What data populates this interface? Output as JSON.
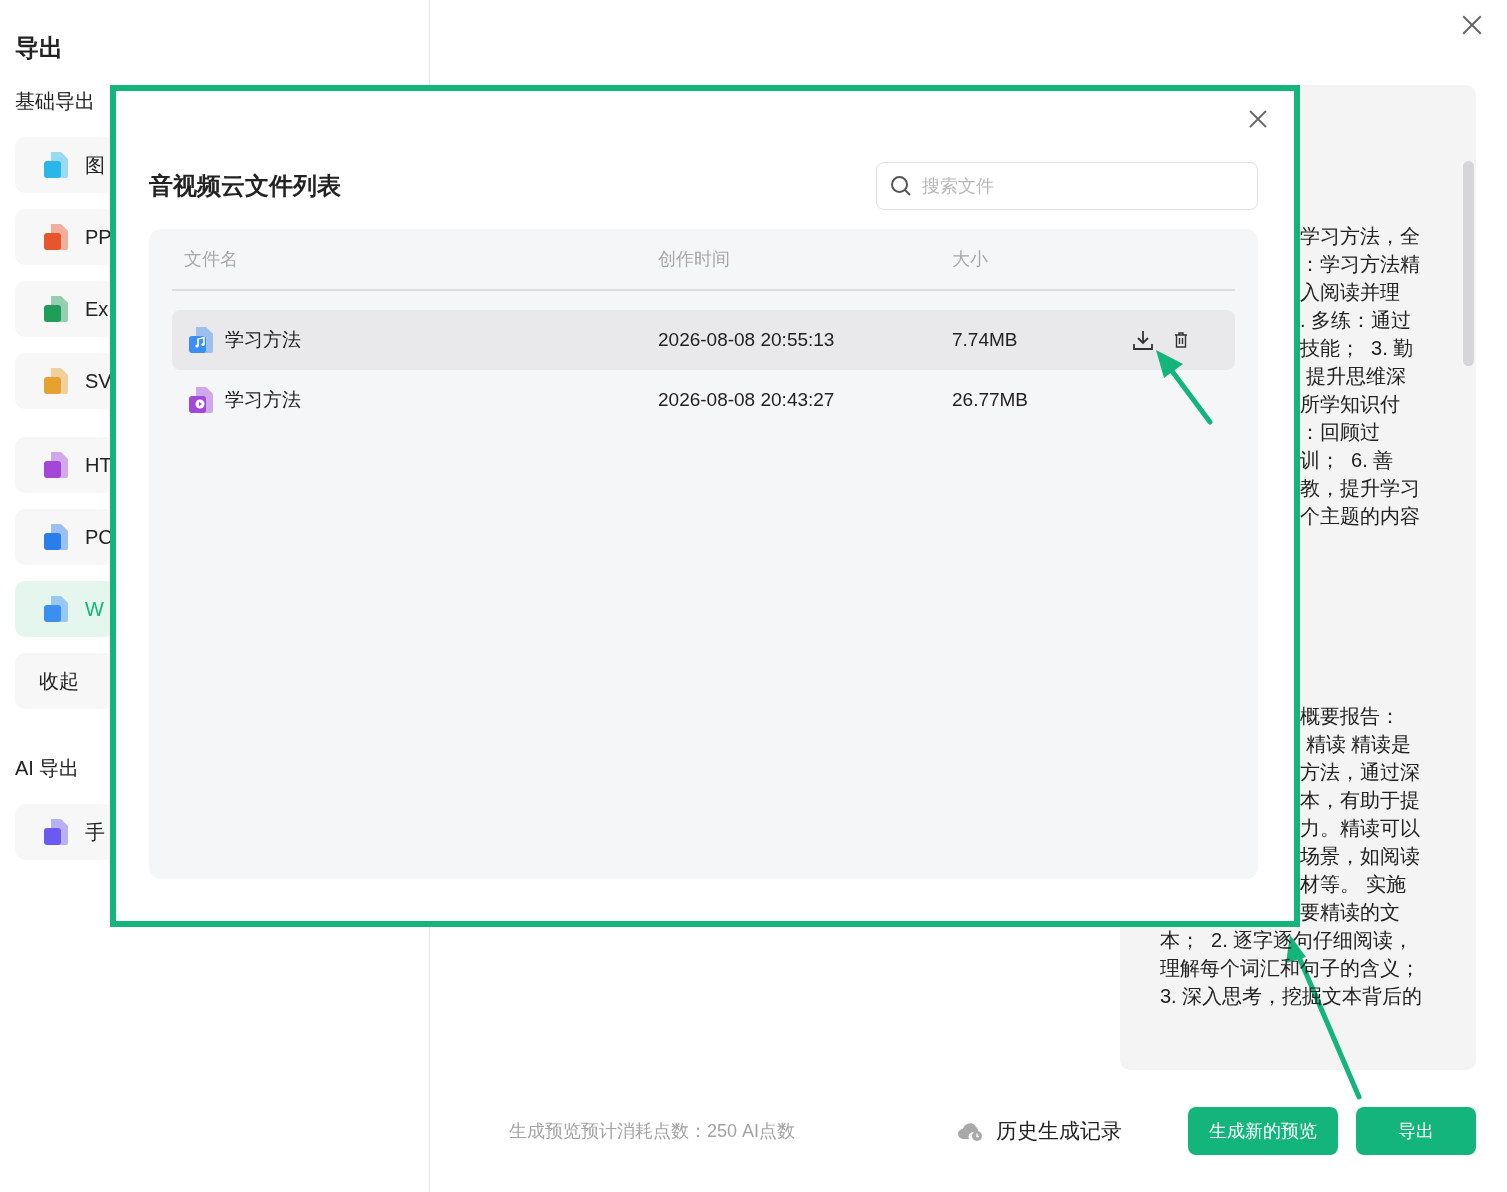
{
  "sidebar": {
    "title": "导出",
    "sections": [
      {
        "heading": "基础导出",
        "items": [
          {
            "kind": "export",
            "label": "图",
            "color": "#29b6e8",
            "selected": false
          },
          {
            "kind": "export",
            "label": "PP",
            "color": "#e8552c",
            "selected": false
          },
          {
            "kind": "export",
            "label": "Ex",
            "color": "#1e9e58",
            "selected": false
          },
          {
            "kind": "export",
            "label": "SV",
            "color": "#e6a12e",
            "selected": false
          },
          {
            "kind": "export",
            "label": "HT",
            "color": "#a347d8",
            "selected": false
          },
          {
            "kind": "export",
            "label": "PC",
            "color": "#2b7de9",
            "selected": false
          },
          {
            "kind": "export",
            "label": "W",
            "color": "#3b8ff0",
            "selected": true
          },
          {
            "kind": "collapse",
            "label": "收起",
            "selected": false
          }
        ]
      },
      {
        "heading": "AI 导出",
        "items": [
          {
            "kind": "export",
            "label": "手",
            "color": "#6a5af0",
            "selected": false
          }
        ]
      }
    ]
  },
  "preview": {
    "paragraphs": [
      {
        "lines": [
          {
            "text": "学习方法，全",
            "clipped": true
          },
          {
            "text": "：学习方法精",
            "clipped": true
          },
          {
            "text": "入阅读并理",
            "clipped": true
          },
          {
            "text": ". 多练：通过",
            "clipped": true
          },
          {
            "text": "技能；  3. 勤",
            "clipped": true
          },
          {
            "text": " 提升思维深",
            "clipped": true
          },
          {
            "text": "所学知识付",
            "clipped": true
          },
          {
            "text": "：回顾过",
            "clipped": true
          },
          {
            "text": "训；  6. 善",
            "clipped": true
          },
          {
            "text": "教，提升学习",
            "clipped": true
          },
          {
            "text": "个主题的内容",
            "clipped": true
          }
        ]
      },
      {
        "lines": [
          {
            "text": "概要报告：",
            "clipped": true
          },
          {
            "text": " 精读 精读是",
            "clipped": true
          },
          {
            "text": "方法，通过深",
            "clipped": true
          },
          {
            "text": "本，有助于提",
            "clipped": true
          },
          {
            "text": "力。精读可以",
            "clipped": true
          },
          {
            "text": "场景，如阅读",
            "clipped": true
          },
          {
            "text": "材等。 实施",
            "clipped": true
          },
          {
            "text": "要精读的文",
            "clipped": true
          },
          {
            "text": "本；  2. 逐字逐句仔细阅读，",
            "clipped": false
          },
          {
            "text": "理解每个词汇和句子的含义；",
            "clipped": false
          },
          {
            "text": "3. 深入思考，挖掘文本背后的",
            "clipped": false
          }
        ]
      }
    ]
  },
  "footer": {
    "cost": "生成预览预计消耗点数：250 AI点数",
    "history": "历史生成记录",
    "buttons": [
      "生成新的预览",
      "导出"
    ]
  },
  "dialog": {
    "title": "音视频云文件列表",
    "search": {
      "placeholder": "搜索文件"
    },
    "table": {
      "columns": [
        "文件名",
        "创作时间",
        "大小"
      ],
      "rows": [
        {
          "kind": "audio",
          "name": "学习方法",
          "time": "2026-08-08 20:55:13",
          "size": "7.74MB",
          "selected": true
        },
        {
          "kind": "video",
          "name": "学习方法",
          "time": "2026-08-08 20:43:27",
          "size": "26.77MB",
          "selected": false
        }
      ]
    }
  }
}
